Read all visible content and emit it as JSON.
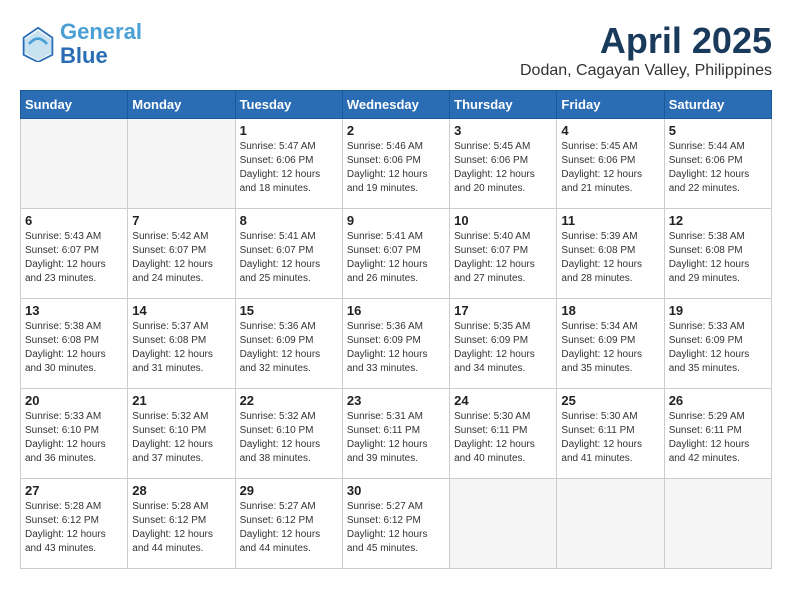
{
  "header": {
    "logo_line1": "General",
    "logo_line2": "Blue",
    "month_title": "April 2025",
    "subtitle": "Dodan, Cagayan Valley, Philippines"
  },
  "weekdays": [
    "Sunday",
    "Monday",
    "Tuesday",
    "Wednesday",
    "Thursday",
    "Friday",
    "Saturday"
  ],
  "weeks": [
    [
      {
        "day": "",
        "sunrise": "",
        "sunset": "",
        "daylight": "",
        "empty": true
      },
      {
        "day": "",
        "sunrise": "",
        "sunset": "",
        "daylight": "",
        "empty": true
      },
      {
        "day": "1",
        "sunrise": "Sunrise: 5:47 AM",
        "sunset": "Sunset: 6:06 PM",
        "daylight": "Daylight: 12 hours and 18 minutes."
      },
      {
        "day": "2",
        "sunrise": "Sunrise: 5:46 AM",
        "sunset": "Sunset: 6:06 PM",
        "daylight": "Daylight: 12 hours and 19 minutes."
      },
      {
        "day": "3",
        "sunrise": "Sunrise: 5:45 AM",
        "sunset": "Sunset: 6:06 PM",
        "daylight": "Daylight: 12 hours and 20 minutes."
      },
      {
        "day": "4",
        "sunrise": "Sunrise: 5:45 AM",
        "sunset": "Sunset: 6:06 PM",
        "daylight": "Daylight: 12 hours and 21 minutes."
      },
      {
        "day": "5",
        "sunrise": "Sunrise: 5:44 AM",
        "sunset": "Sunset: 6:06 PM",
        "daylight": "Daylight: 12 hours and 22 minutes."
      }
    ],
    [
      {
        "day": "6",
        "sunrise": "Sunrise: 5:43 AM",
        "sunset": "Sunset: 6:07 PM",
        "daylight": "Daylight: 12 hours and 23 minutes."
      },
      {
        "day": "7",
        "sunrise": "Sunrise: 5:42 AM",
        "sunset": "Sunset: 6:07 PM",
        "daylight": "Daylight: 12 hours and 24 minutes."
      },
      {
        "day": "8",
        "sunrise": "Sunrise: 5:41 AM",
        "sunset": "Sunset: 6:07 PM",
        "daylight": "Daylight: 12 hours and 25 minutes."
      },
      {
        "day": "9",
        "sunrise": "Sunrise: 5:41 AM",
        "sunset": "Sunset: 6:07 PM",
        "daylight": "Daylight: 12 hours and 26 minutes."
      },
      {
        "day": "10",
        "sunrise": "Sunrise: 5:40 AM",
        "sunset": "Sunset: 6:07 PM",
        "daylight": "Daylight: 12 hours and 27 minutes."
      },
      {
        "day": "11",
        "sunrise": "Sunrise: 5:39 AM",
        "sunset": "Sunset: 6:08 PM",
        "daylight": "Daylight: 12 hours and 28 minutes."
      },
      {
        "day": "12",
        "sunrise": "Sunrise: 5:38 AM",
        "sunset": "Sunset: 6:08 PM",
        "daylight": "Daylight: 12 hours and 29 minutes."
      }
    ],
    [
      {
        "day": "13",
        "sunrise": "Sunrise: 5:38 AM",
        "sunset": "Sunset: 6:08 PM",
        "daylight": "Daylight: 12 hours and 30 minutes."
      },
      {
        "day": "14",
        "sunrise": "Sunrise: 5:37 AM",
        "sunset": "Sunset: 6:08 PM",
        "daylight": "Daylight: 12 hours and 31 minutes."
      },
      {
        "day": "15",
        "sunrise": "Sunrise: 5:36 AM",
        "sunset": "Sunset: 6:09 PM",
        "daylight": "Daylight: 12 hours and 32 minutes."
      },
      {
        "day": "16",
        "sunrise": "Sunrise: 5:36 AM",
        "sunset": "Sunset: 6:09 PM",
        "daylight": "Daylight: 12 hours and 33 minutes."
      },
      {
        "day": "17",
        "sunrise": "Sunrise: 5:35 AM",
        "sunset": "Sunset: 6:09 PM",
        "daylight": "Daylight: 12 hours and 34 minutes."
      },
      {
        "day": "18",
        "sunrise": "Sunrise: 5:34 AM",
        "sunset": "Sunset: 6:09 PM",
        "daylight": "Daylight: 12 hours and 35 minutes."
      },
      {
        "day": "19",
        "sunrise": "Sunrise: 5:33 AM",
        "sunset": "Sunset: 6:09 PM",
        "daylight": "Daylight: 12 hours and 35 minutes."
      }
    ],
    [
      {
        "day": "20",
        "sunrise": "Sunrise: 5:33 AM",
        "sunset": "Sunset: 6:10 PM",
        "daylight": "Daylight: 12 hours and 36 minutes."
      },
      {
        "day": "21",
        "sunrise": "Sunrise: 5:32 AM",
        "sunset": "Sunset: 6:10 PM",
        "daylight": "Daylight: 12 hours and 37 minutes."
      },
      {
        "day": "22",
        "sunrise": "Sunrise: 5:32 AM",
        "sunset": "Sunset: 6:10 PM",
        "daylight": "Daylight: 12 hours and 38 minutes."
      },
      {
        "day": "23",
        "sunrise": "Sunrise: 5:31 AM",
        "sunset": "Sunset: 6:11 PM",
        "daylight": "Daylight: 12 hours and 39 minutes."
      },
      {
        "day": "24",
        "sunrise": "Sunrise: 5:30 AM",
        "sunset": "Sunset: 6:11 PM",
        "daylight": "Daylight: 12 hours and 40 minutes."
      },
      {
        "day": "25",
        "sunrise": "Sunrise: 5:30 AM",
        "sunset": "Sunset: 6:11 PM",
        "daylight": "Daylight: 12 hours and 41 minutes."
      },
      {
        "day": "26",
        "sunrise": "Sunrise: 5:29 AM",
        "sunset": "Sunset: 6:11 PM",
        "daylight": "Daylight: 12 hours and 42 minutes."
      }
    ],
    [
      {
        "day": "27",
        "sunrise": "Sunrise: 5:28 AM",
        "sunset": "Sunset: 6:12 PM",
        "daylight": "Daylight: 12 hours and 43 minutes."
      },
      {
        "day": "28",
        "sunrise": "Sunrise: 5:28 AM",
        "sunset": "Sunset: 6:12 PM",
        "daylight": "Daylight: 12 hours and 44 minutes."
      },
      {
        "day": "29",
        "sunrise": "Sunrise: 5:27 AM",
        "sunset": "Sunset: 6:12 PM",
        "daylight": "Daylight: 12 hours and 44 minutes."
      },
      {
        "day": "30",
        "sunrise": "Sunrise: 5:27 AM",
        "sunset": "Sunset: 6:12 PM",
        "daylight": "Daylight: 12 hours and 45 minutes."
      },
      {
        "day": "",
        "sunrise": "",
        "sunset": "",
        "daylight": "",
        "empty": true
      },
      {
        "day": "",
        "sunrise": "",
        "sunset": "",
        "daylight": "",
        "empty": true
      },
      {
        "day": "",
        "sunrise": "",
        "sunset": "",
        "daylight": "",
        "empty": true
      }
    ]
  ]
}
